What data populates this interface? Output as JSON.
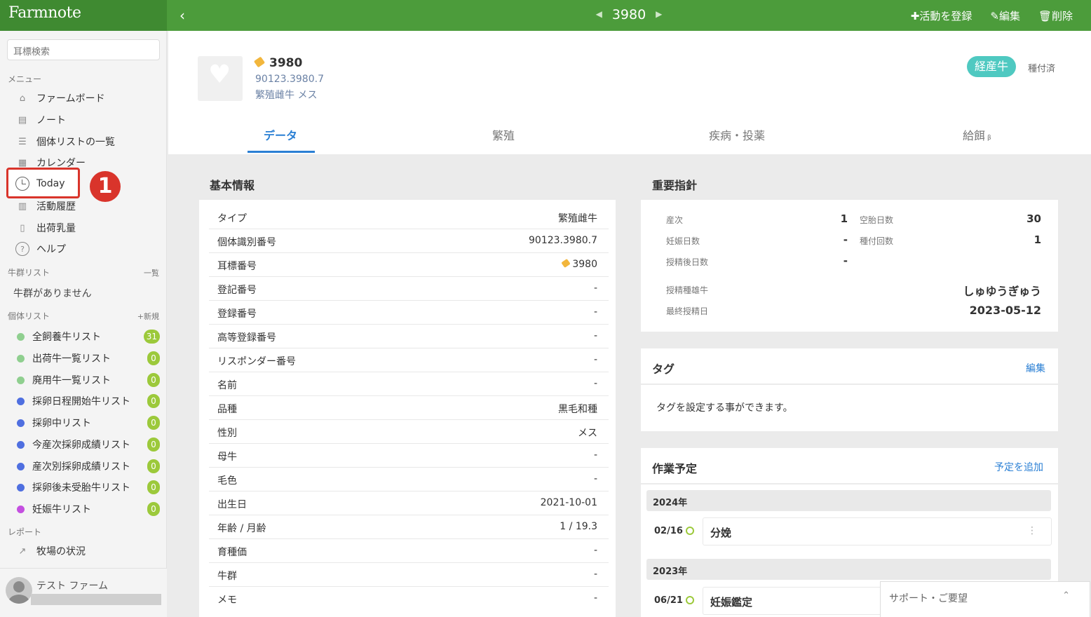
{
  "app": {
    "logo": "Farmnote"
  },
  "topbar": {
    "back": "‹",
    "prev": "◀",
    "next": "▶",
    "title": "3980",
    "actions": {
      "add_activity": "✚活動を登録",
      "edit": "✎編集",
      "delete": "🗑削除"
    }
  },
  "sidebar": {
    "search_placeholder": "耳標検索",
    "menu_label": "メニュー",
    "menu": [
      {
        "label": "ファームボード",
        "icon": "farm-icon"
      },
      {
        "label": "ノート",
        "icon": "note-icon"
      },
      {
        "label": "個体リストの一覧",
        "icon": "list-icon"
      },
      {
        "label": "カレンダー",
        "icon": "calendar-icon"
      },
      {
        "label": "Today",
        "icon": "clock-icon"
      },
      {
        "label": "活動履歴",
        "icon": "history-icon"
      },
      {
        "label": "出荷乳量",
        "icon": "milk-icon"
      },
      {
        "label": "ヘルプ",
        "icon": "help-icon"
      }
    ],
    "herd_label": "牛群リスト",
    "herd_all": "一覧",
    "herd_empty": "牛群がありません",
    "cow_list_label": "個体リスト",
    "cow_list_new": "+新規",
    "cow_lists": [
      {
        "label": "全飼養牛リスト",
        "count": "31",
        "color": "#8fcf8f"
      },
      {
        "label": "出荷牛一覧リスト",
        "count": "0",
        "color": "#8fcf8f"
      },
      {
        "label": "廃用牛一覧リスト",
        "count": "0",
        "color": "#8fcf8f"
      },
      {
        "label": "採卵日程開始牛リスト",
        "count": "0",
        "color": "#4f6fe0"
      },
      {
        "label": "採卵中リスト",
        "count": "0",
        "color": "#4f6fe0"
      },
      {
        "label": "今産次採卵成績リスト",
        "count": "0",
        "color": "#4f6fe0"
      },
      {
        "label": "産次別採卵成績リスト",
        "count": "0",
        "color": "#4f6fe0"
      },
      {
        "label": "採卵後未受胎牛リスト",
        "count": "0",
        "color": "#4f6fe0"
      },
      {
        "label": "妊娠牛リスト",
        "count": "0",
        "color": "#c44fe0"
      }
    ],
    "report_label": "レポート",
    "report_item": "牧場の状況",
    "user_farm": "テスト ファーム",
    "annotation_number": "1"
  },
  "cow": {
    "tag": "3980",
    "id": "90123.3980.7",
    "type_sex": "繁殖雌牛 メス",
    "parity_badge": "経産牛",
    "status": "種付済"
  },
  "tabs": [
    {
      "label": "データ"
    },
    {
      "label": "繁殖"
    },
    {
      "label": "疾病・投薬"
    },
    {
      "label": "給餌",
      "suffix": "β"
    }
  ],
  "basic": {
    "title": "基本情報",
    "rows": [
      {
        "k": "タイプ",
        "v": "繁殖雌牛"
      },
      {
        "k": "個体識別番号",
        "v": "90123.3980.7"
      },
      {
        "k": "耳標番号",
        "v": "3980"
      },
      {
        "k": "登記番号",
        "v": "-"
      },
      {
        "k": "登録番号",
        "v": "-"
      },
      {
        "k": "高等登録番号",
        "v": "-"
      },
      {
        "k": "リスポンダー番号",
        "v": "-"
      },
      {
        "k": "名前",
        "v": "-"
      },
      {
        "k": "品種",
        "v": "黒毛和種"
      },
      {
        "k": "性別",
        "v": "メス"
      },
      {
        "k": "母牛",
        "v": "-"
      },
      {
        "k": "毛色",
        "v": "-"
      },
      {
        "k": "出生日",
        "v": "2021-10-01"
      },
      {
        "k": "年齢 / 月齢",
        "v": "1 / 19.3"
      },
      {
        "k": "育種価",
        "v": "-"
      },
      {
        "k": "牛群",
        "v": "-"
      },
      {
        "k": "メモ",
        "v": "-"
      }
    ]
  },
  "important": {
    "title": "重要指針",
    "parity_k": "産次",
    "parity_v": "1",
    "open_days_k": "空胎日数",
    "open_days_v": "30",
    "pregnant_days_k": "妊娠日数",
    "pregnant_days_v": "-",
    "insem_count_k": "種付回数",
    "insem_count_v": "1",
    "days_after_k": "授精後日数",
    "days_after_v": "-",
    "sire_k": "授精種雄牛",
    "sire_v": "しゅゆうぎゅう",
    "last_insem_k": "最終授精日",
    "last_insem_v": "2023-05-12"
  },
  "tags": {
    "title": "タグ",
    "edit": "編集",
    "empty": "タグを設定する事ができます。"
  },
  "schedule": {
    "title": "作業予定",
    "add": "予定を追加",
    "groups": [
      {
        "year": "2024年",
        "date": "02/16",
        "event": "分娩"
      },
      {
        "year": "2023年",
        "date": "06/21",
        "event": "妊娠鑑定"
      }
    ]
  },
  "support": {
    "label": "サポート・ご要望",
    "caret": "⌃"
  }
}
